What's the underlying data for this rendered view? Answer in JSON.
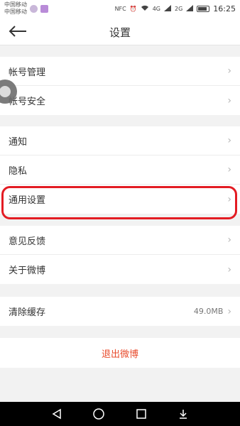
{
  "status_bar": {
    "carrier1": "中国移动",
    "carrier2": "中国移动",
    "nfc": "NFC",
    "net1": "4G",
    "net2": "2G",
    "time": "16:25"
  },
  "nav": {
    "title": "设置"
  },
  "groups": [
    {
      "items": [
        {
          "label": "帐号管理"
        },
        {
          "label": "帐号安全"
        }
      ]
    },
    {
      "items": [
        {
          "label": "通知"
        },
        {
          "label": "隐私"
        },
        {
          "label": "通用设置"
        }
      ]
    },
    {
      "items": [
        {
          "label": "意见反馈"
        },
        {
          "label": "关于微博"
        }
      ]
    },
    {
      "items": [
        {
          "label": "清除缓存",
          "value": "49.0MB"
        }
      ]
    }
  ],
  "logout_label": "退出微博",
  "colors": {
    "highlight": "#e31c23",
    "logout": "#e84b2c"
  },
  "icons": [
    "back-arrow-icon",
    "chevron-right-icon",
    "nav-back-icon",
    "nav-home-icon",
    "nav-recent-icon",
    "nav-notification-icon"
  ]
}
